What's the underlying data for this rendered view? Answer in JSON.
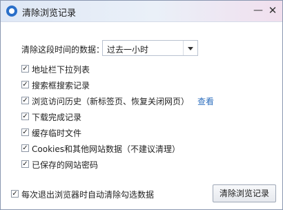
{
  "window": {
    "title": "清除浏览记录",
    "min_glyph": "—",
    "close_glyph": "✕"
  },
  "range": {
    "label": "清除这段时间的数据：",
    "selected": "过去一小时"
  },
  "options": [
    {
      "label": "地址栏下拉列表",
      "checked": true
    },
    {
      "label": "搜索框搜索记录",
      "checked": true
    },
    {
      "label": "浏览访问历史（新标签页、恢复关闭网页）",
      "checked": true
    },
    {
      "label": "下载完成记录",
      "checked": true
    },
    {
      "label": "缓存临时文件",
      "checked": true
    },
    {
      "label": "Cookies和其他网站数据（不建议清理）",
      "checked": true
    },
    {
      "label": "已保存的网站密码",
      "checked": true
    }
  ],
  "view_link": "查看",
  "auto_clear": {
    "label": "每次退出浏览器时自动清除勾选数据",
    "checked": true
  },
  "clear_button": "清除浏览记录",
  "check_glyph": "✓"
}
